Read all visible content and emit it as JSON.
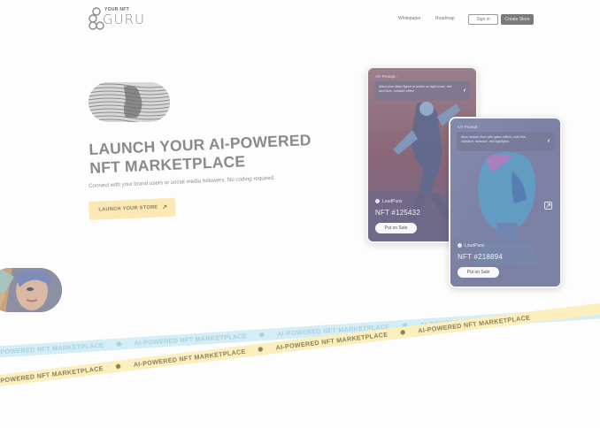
{
  "header": {
    "logo_tagline": "YOUR NFT",
    "logo_word": "GURU",
    "nav_links": [
      "Whitepaper",
      "Roadmap"
    ],
    "signin_label": "Sign in",
    "create_store_label": "Create Store"
  },
  "hero": {
    "title_line1": "LAUNCH YOUR AI-POWERED",
    "title_line2": "NFT MARKETPLACE",
    "subtitle": "Connect with your brand users or social media followers. No coding required.",
    "cta_label": "LAUNCH YOUR STORE",
    "cta_icon": "arrow-up-right-icon"
  },
  "cards": [
    {
      "prompt_label": "</> Prompt :",
      "prompt_text": "Masculine Male figure in action on light tools, red and blue, metallic effect",
      "creator": "LoudPunx",
      "nft_id": "NFT #125432",
      "sale_label": "Put on Sale"
    },
    {
      "prompt_label": "</> Prompt :",
      "prompt_text": "Blue human face with glass effect, cold hue, sidelace, abstract, red highlights",
      "creator": "LoudPunx",
      "nft_id": "NFT #218894",
      "sale_label": "Put on Sale"
    }
  ],
  "ribbons": {
    "text": "AI-POWERED NFT MARKETPLACE",
    "separator": "✺",
    "blue_color": "#d5edf4",
    "yellow_color": "#fbeebf"
  },
  "colors": {
    "accent_yellow": "#fbe8b4",
    "button_dark": "#7a7a7a"
  }
}
